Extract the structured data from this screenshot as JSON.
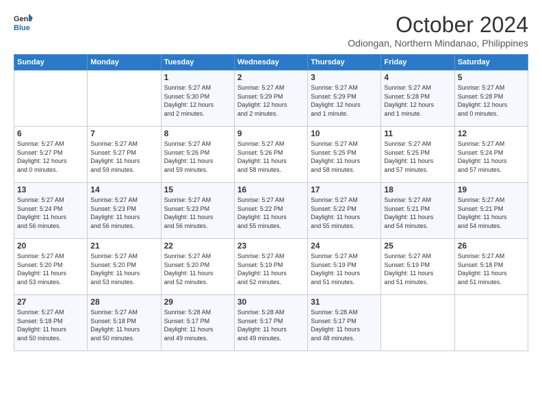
{
  "header": {
    "logo_line1": "General",
    "logo_line2": "Blue",
    "month": "October 2024",
    "location": "Odiongan, Northern Mindanao, Philippines"
  },
  "days_of_week": [
    "Sunday",
    "Monday",
    "Tuesday",
    "Wednesday",
    "Thursday",
    "Friday",
    "Saturday"
  ],
  "weeks": [
    [
      {
        "day": "",
        "text": ""
      },
      {
        "day": "",
        "text": ""
      },
      {
        "day": "1",
        "text": "Sunrise: 5:27 AM\nSunset: 5:30 PM\nDaylight: 12 hours\nand 2 minutes."
      },
      {
        "day": "2",
        "text": "Sunrise: 5:27 AM\nSunset: 5:29 PM\nDaylight: 12 hours\nand 2 minutes."
      },
      {
        "day": "3",
        "text": "Sunrise: 5:27 AM\nSunset: 5:29 PM\nDaylight: 12 hours\nand 1 minute."
      },
      {
        "day": "4",
        "text": "Sunrise: 5:27 AM\nSunset: 5:28 PM\nDaylight: 12 hours\nand 1 minute."
      },
      {
        "day": "5",
        "text": "Sunrise: 5:27 AM\nSunset: 5:28 PM\nDaylight: 12 hours\nand 0 minutes."
      }
    ],
    [
      {
        "day": "6",
        "text": "Sunrise: 5:27 AM\nSunset: 5:27 PM\nDaylight: 12 hours\nand 0 minutes."
      },
      {
        "day": "7",
        "text": "Sunrise: 5:27 AM\nSunset: 5:27 PM\nDaylight: 11 hours\nand 59 minutes."
      },
      {
        "day": "8",
        "text": "Sunrise: 5:27 AM\nSunset: 5:26 PM\nDaylight: 11 hours\nand 59 minutes."
      },
      {
        "day": "9",
        "text": "Sunrise: 5:27 AM\nSunset: 5:26 PM\nDaylight: 11 hours\nand 58 minutes."
      },
      {
        "day": "10",
        "text": "Sunrise: 5:27 AM\nSunset: 5:25 PM\nDaylight: 11 hours\nand 58 minutes."
      },
      {
        "day": "11",
        "text": "Sunrise: 5:27 AM\nSunset: 5:25 PM\nDaylight: 11 hours\nand 57 minutes."
      },
      {
        "day": "12",
        "text": "Sunrise: 5:27 AM\nSunset: 5:24 PM\nDaylight: 11 hours\nand 57 minutes."
      }
    ],
    [
      {
        "day": "13",
        "text": "Sunrise: 5:27 AM\nSunset: 5:24 PM\nDaylight: 11 hours\nand 56 minutes."
      },
      {
        "day": "14",
        "text": "Sunrise: 5:27 AM\nSunset: 5:23 PM\nDaylight: 11 hours\nand 56 minutes."
      },
      {
        "day": "15",
        "text": "Sunrise: 5:27 AM\nSunset: 5:23 PM\nDaylight: 11 hours\nand 56 minutes."
      },
      {
        "day": "16",
        "text": "Sunrise: 5:27 AM\nSunset: 5:22 PM\nDaylight: 11 hours\nand 55 minutes."
      },
      {
        "day": "17",
        "text": "Sunrise: 5:27 AM\nSunset: 5:22 PM\nDaylight: 11 hours\nand 55 minutes."
      },
      {
        "day": "18",
        "text": "Sunrise: 5:27 AM\nSunset: 5:21 PM\nDaylight: 11 hours\nand 54 minutes."
      },
      {
        "day": "19",
        "text": "Sunrise: 5:27 AM\nSunset: 5:21 PM\nDaylight: 11 hours\nand 54 minutes."
      }
    ],
    [
      {
        "day": "20",
        "text": "Sunrise: 5:27 AM\nSunset: 5:20 PM\nDaylight: 11 hours\nand 53 minutes."
      },
      {
        "day": "21",
        "text": "Sunrise: 5:27 AM\nSunset: 5:20 PM\nDaylight: 11 hours\nand 53 minutes."
      },
      {
        "day": "22",
        "text": "Sunrise: 5:27 AM\nSunset: 5:20 PM\nDaylight: 11 hours\nand 52 minutes."
      },
      {
        "day": "23",
        "text": "Sunrise: 5:27 AM\nSunset: 5:19 PM\nDaylight: 11 hours\nand 52 minutes."
      },
      {
        "day": "24",
        "text": "Sunrise: 5:27 AM\nSunset: 5:19 PM\nDaylight: 11 hours\nand 51 minutes."
      },
      {
        "day": "25",
        "text": "Sunrise: 5:27 AM\nSunset: 5:19 PM\nDaylight: 11 hours\nand 51 minutes."
      },
      {
        "day": "26",
        "text": "Sunrise: 5:27 AM\nSunset: 5:18 PM\nDaylight: 11 hours\nand 51 minutes."
      }
    ],
    [
      {
        "day": "27",
        "text": "Sunrise: 5:27 AM\nSunset: 5:18 PM\nDaylight: 11 hours\nand 50 minutes."
      },
      {
        "day": "28",
        "text": "Sunrise: 5:27 AM\nSunset: 5:18 PM\nDaylight: 11 hours\nand 50 minutes."
      },
      {
        "day": "29",
        "text": "Sunrise: 5:28 AM\nSunset: 5:17 PM\nDaylight: 11 hours\nand 49 minutes."
      },
      {
        "day": "30",
        "text": "Sunrise: 5:28 AM\nSunset: 5:17 PM\nDaylight: 11 hours\nand 49 minutes."
      },
      {
        "day": "31",
        "text": "Sunrise: 5:28 AM\nSunset: 5:17 PM\nDaylight: 11 hours\nand 48 minutes."
      },
      {
        "day": "",
        "text": ""
      },
      {
        "day": "",
        "text": ""
      }
    ]
  ]
}
